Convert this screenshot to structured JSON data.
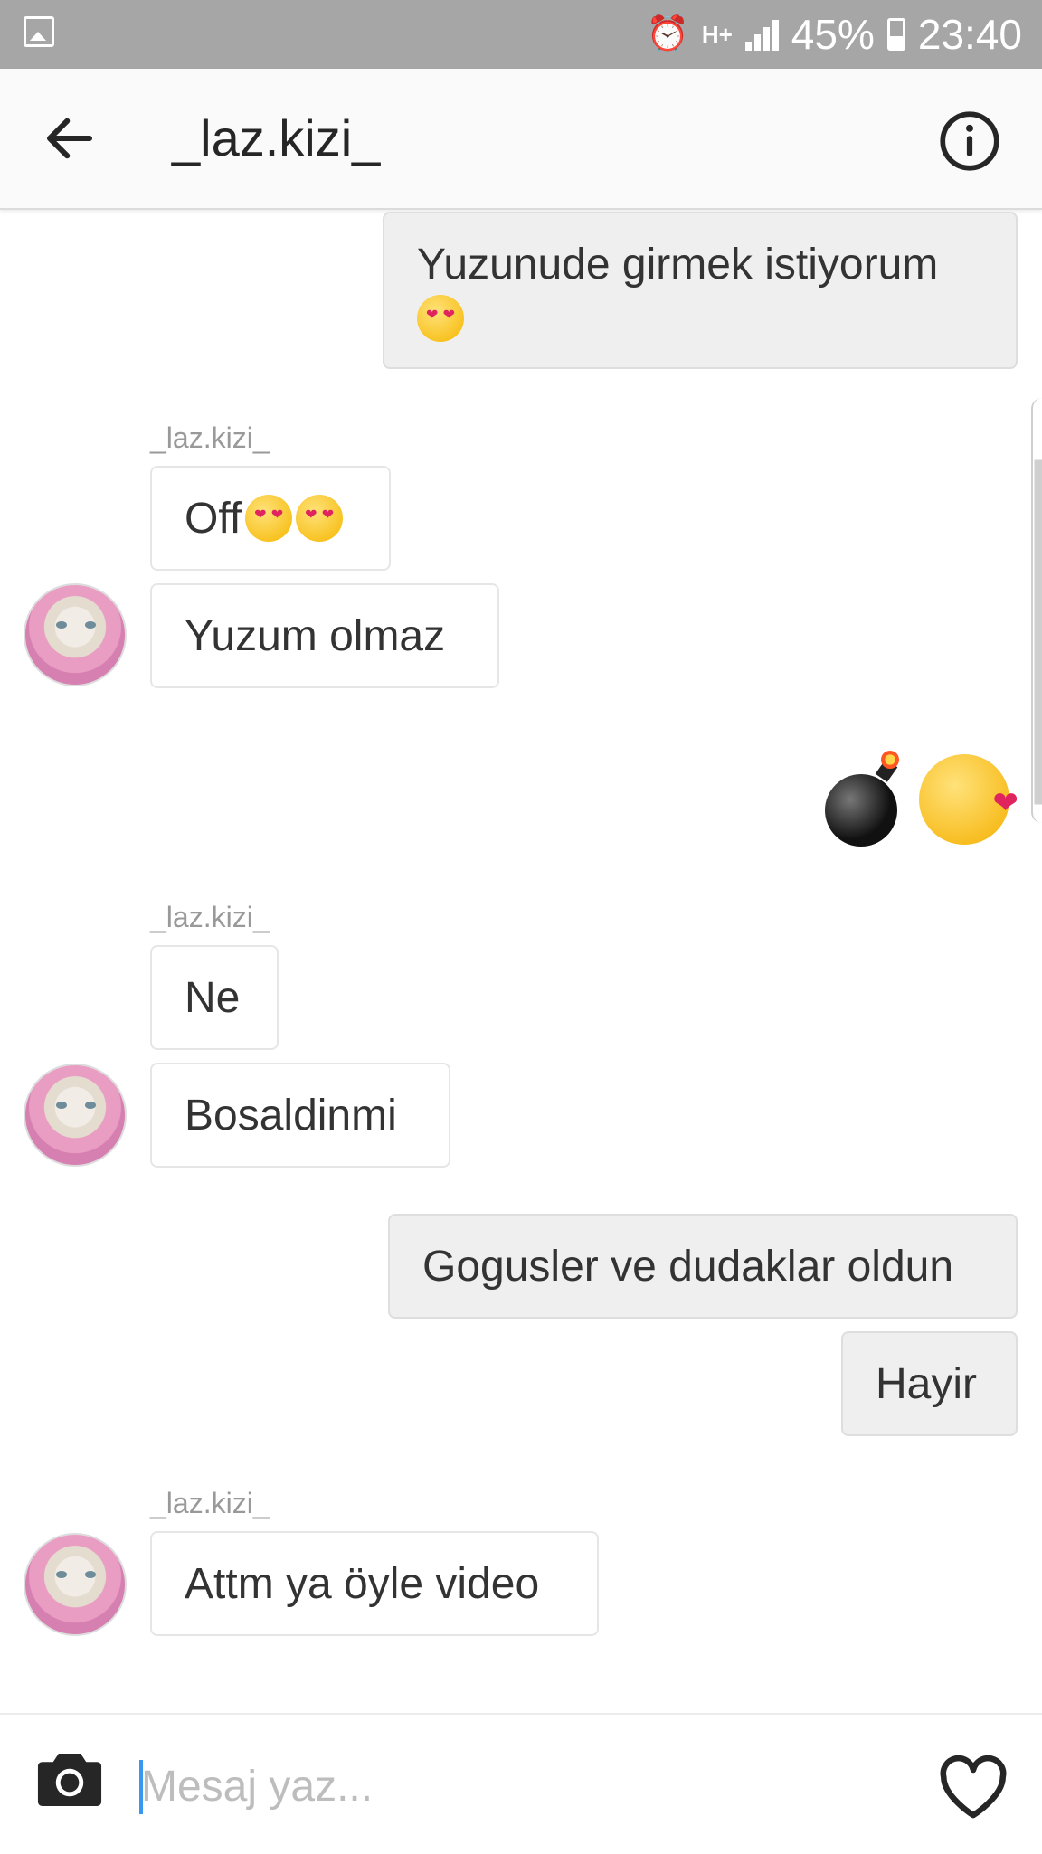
{
  "statusbar": {
    "battery": "45%",
    "time": "23:40",
    "network": "H+"
  },
  "header": {
    "title": "_laz.kizi_"
  },
  "messages": [
    {
      "from": "me",
      "text": "Yuzunude girmek istiyorum",
      "emoji": "heart-eyes"
    },
    {
      "from": "them",
      "sender": "_laz.kizi_",
      "text": "Off",
      "emoji": "heart-eyes x2"
    },
    {
      "from": "them",
      "text": "Yuzum olmaz"
    },
    {
      "from": "me",
      "emoji": "bomb, kissing-heart"
    },
    {
      "from": "them",
      "sender": "_laz.kizi_",
      "text": "Ne"
    },
    {
      "from": "them",
      "text": "Bosaldinmi"
    },
    {
      "from": "me",
      "text": "Gogusler ve dudaklar oldun"
    },
    {
      "from": "me",
      "text": "Hayir"
    },
    {
      "from": "them",
      "sender": "_laz.kizi_",
      "text": "Attm ya öyle video"
    }
  ],
  "composer": {
    "placeholder": "Mesaj yaz..."
  },
  "icons": {
    "back": "arrow-left-icon",
    "info": "info-icon",
    "camera": "camera-icon",
    "like": "heart-icon"
  }
}
